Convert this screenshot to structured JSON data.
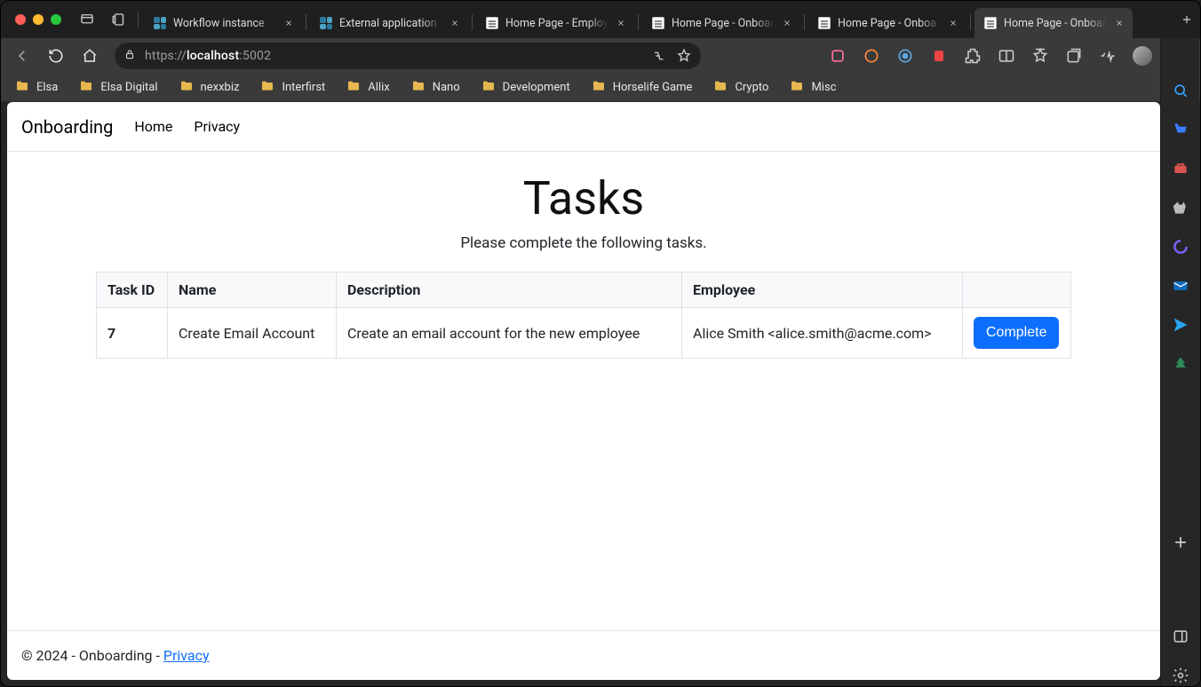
{
  "browser": {
    "tabs": [
      {
        "title": "Workflow instance",
        "favicon": "elsa",
        "active": false
      },
      {
        "title": "External application :",
        "favicon": "elsa",
        "active": false
      },
      {
        "title": "Home Page - Employ",
        "favicon": "doc",
        "active": false
      },
      {
        "title": "Home Page - Onboar",
        "favicon": "doc",
        "active": false
      },
      {
        "title": "Home Page - Onboa",
        "favicon": "doc",
        "active": false
      },
      {
        "title": "Home Page - Onboar",
        "favicon": "doc",
        "active": true
      }
    ],
    "url": {
      "protocol": "https://",
      "host": "localhost",
      "port": ":5002"
    },
    "bookmarks": [
      "Elsa",
      "Elsa Digital",
      "nexxbiz",
      "Interfirst",
      "Allix",
      "Nano",
      "Development",
      "Horselife Game",
      "Crypto",
      "Misc"
    ]
  },
  "navbar": {
    "brand": "Onboarding",
    "links": [
      "Home",
      "Privacy"
    ]
  },
  "page": {
    "title": "Tasks",
    "subtitle": "Please complete the following tasks."
  },
  "table": {
    "headers": [
      "Task ID",
      "Name",
      "Description",
      "Employee",
      ""
    ],
    "rows": [
      {
        "id": "7",
        "name": "Create Email Account",
        "description": "Create an email account for the new employee",
        "employee": "Alice Smith <alice.smith@acme.com>",
        "action_label": "Complete"
      }
    ]
  },
  "footer": {
    "text_before": "© 2024 - Onboarding - ",
    "privacy_label": "Privacy"
  }
}
